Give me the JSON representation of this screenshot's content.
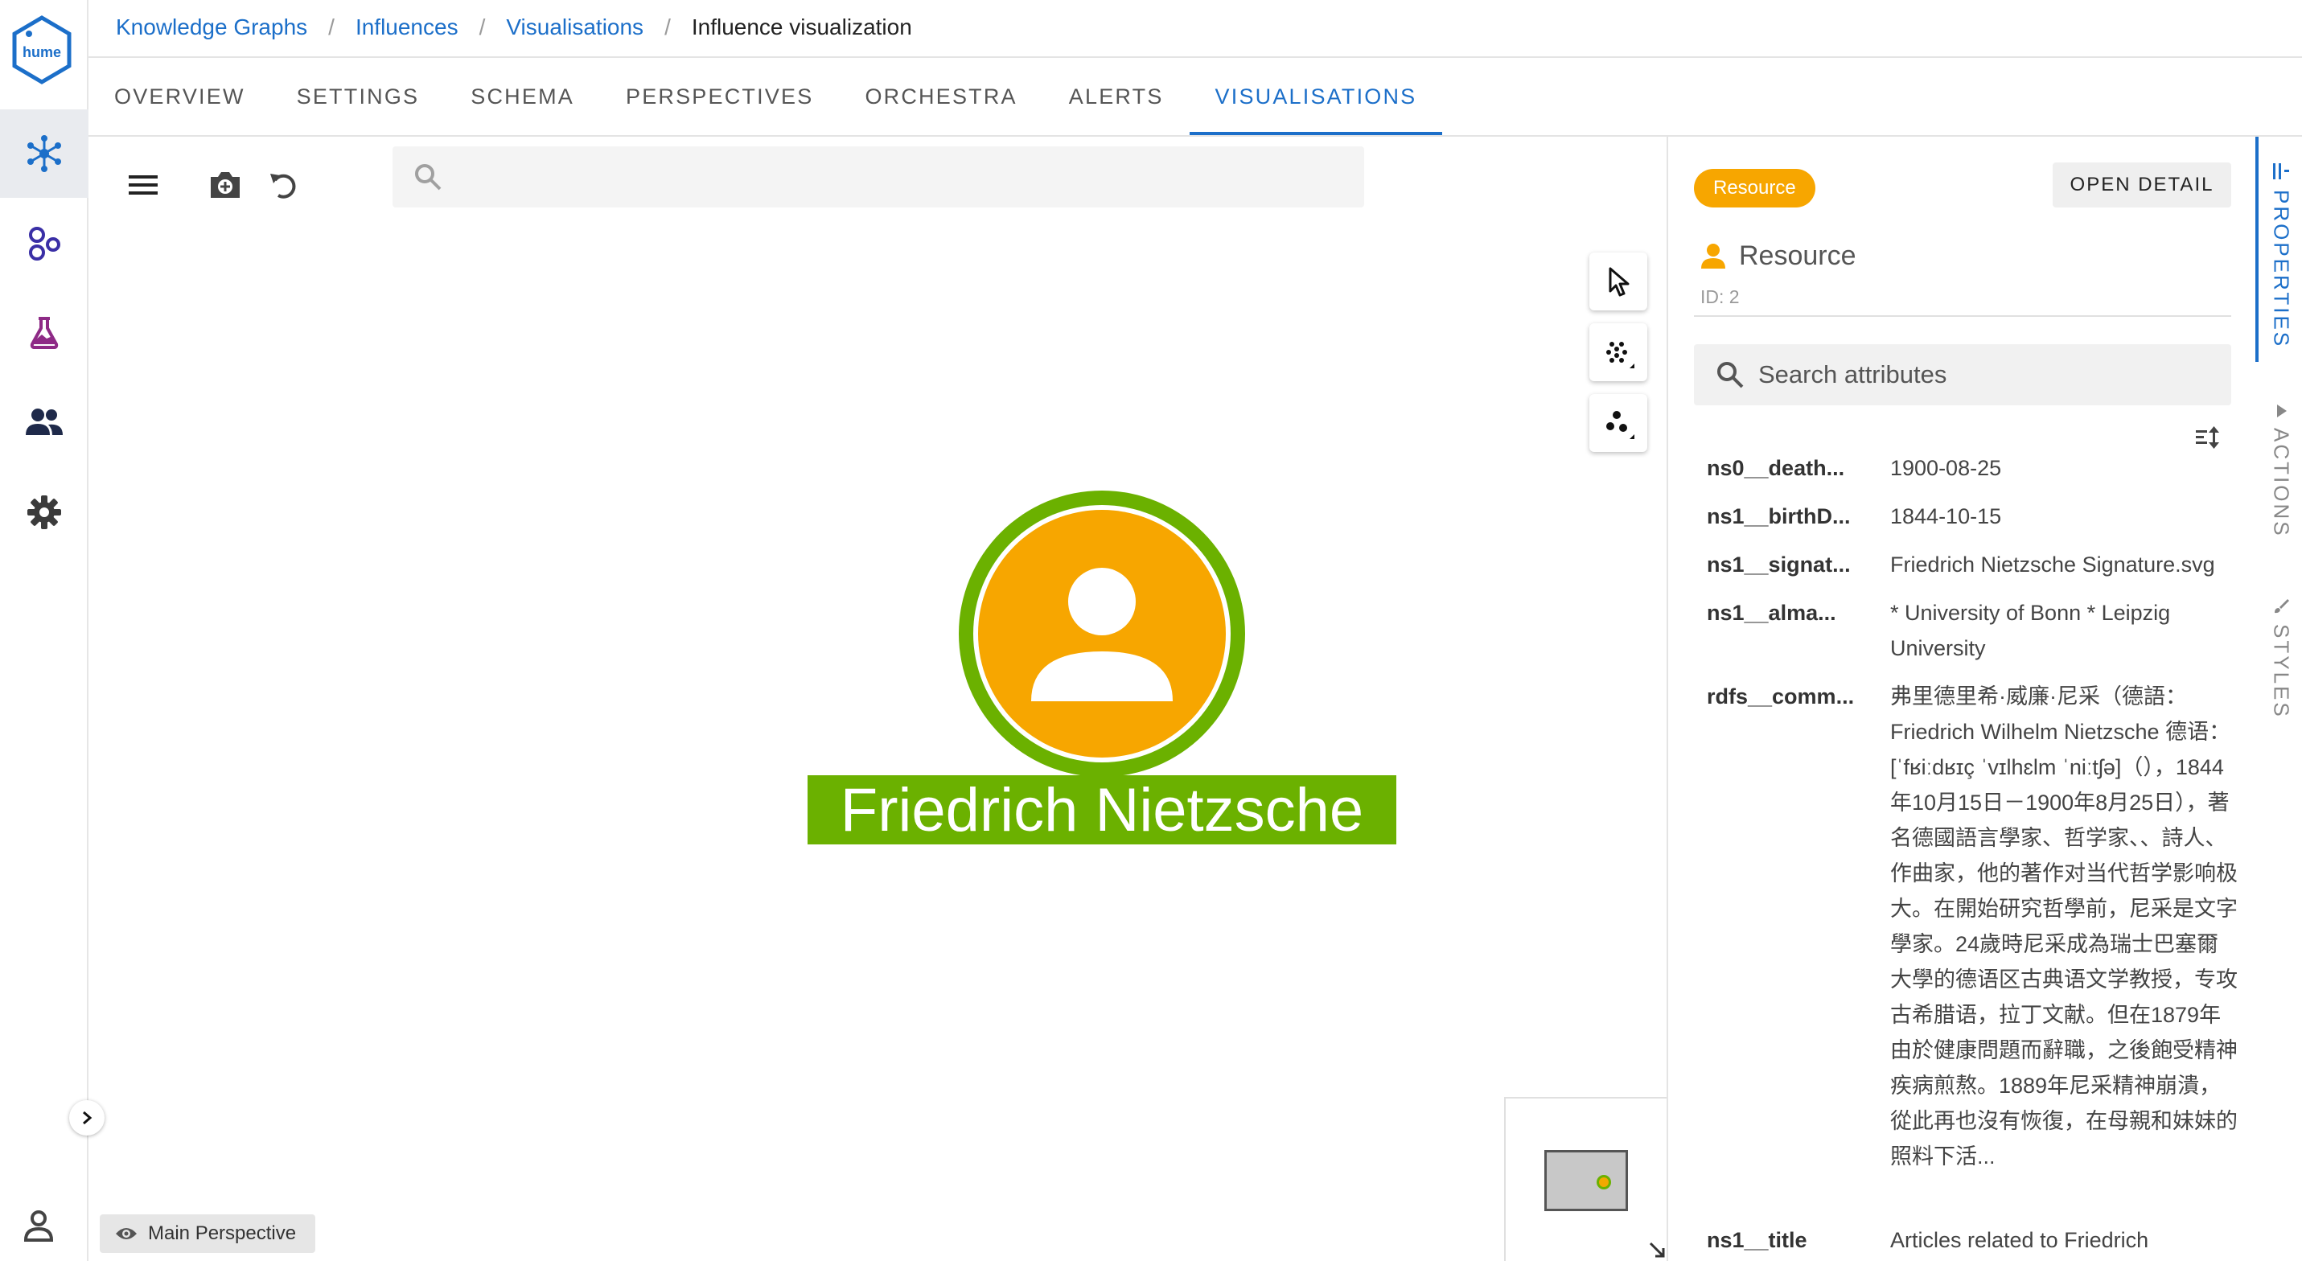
{
  "brand": {
    "logo_text": "hume"
  },
  "breadcrumb": {
    "items": [
      "Knowledge Graphs",
      "Influences",
      "Visualisations"
    ],
    "current": "Influence visualization",
    "separator": "/"
  },
  "tabs": [
    {
      "label": "OVERVIEW"
    },
    {
      "label": "SETTINGS"
    },
    {
      "label": "SCHEMA"
    },
    {
      "label": "PERSPECTIVES"
    },
    {
      "label": "ORCHESTRA"
    },
    {
      "label": "ALERTS"
    },
    {
      "label": "VISUALISATIONS",
      "active": true
    }
  ],
  "rail": {
    "items": [
      {
        "icon": "graph-network-icon",
        "active": true
      },
      {
        "icon": "bubbles-icon"
      },
      {
        "icon": "flask-icon"
      },
      {
        "icon": "people-icon"
      },
      {
        "icon": "gear-icon"
      }
    ],
    "bottom_icon": "user-account-icon"
  },
  "canvas": {
    "search_placeholder": "",
    "node": {
      "label": "Friedrich Nietzsche",
      "fill": "#F7A600",
      "ring": "#6BB100"
    },
    "perspective": "Main Perspective"
  },
  "panel": {
    "badge": "Resource",
    "open_detail": "OPEN DETAIL",
    "title": "Resource",
    "id_text": "ID: 2",
    "search_placeholder": "Search attributes",
    "attributes": [
      {
        "key": "ns0__death...",
        "value": "1900-08-25"
      },
      {
        "key": "ns1__birthD...",
        "value": "1844-10-15"
      },
      {
        "key": "ns1__signat...",
        "value": "Friedrich Nietzsche Signature.svg"
      },
      {
        "key": "ns1__alma...",
        "value": "* University of Bonn * Leipzig University"
      },
      {
        "key": "rdfs__comm...",
        "value": "弗里德里希·威廉·尼采（德語：Friedrich Wilhelm Nietzsche 德语：[ˈfʁiːdʁɪç ˈvɪlhɛlm ˈniːtʃə]（），1844年10月15日－1900年8月25日），著名德國語言學家、哲学家、、詩人、作曲家，他的著作对当代哲学影响极大。在開始研究哲學前，尼采是文字學家。24歲時尼采成為瑞士巴塞爾大學的德语区古典语文学教授，专攻古希腊语，拉丁文献。但在1879年由於健康問題而辭職，之後飽受精神疾病煎熬。1889年尼采精神崩潰，從此再也沒有恢復，在母親和妹妹的照料下活..."
      },
      {
        "key": "ns1__title",
        "value": "Articles related to Friedrich"
      }
    ]
  },
  "side_tabs": [
    {
      "label": "PROPERTIES",
      "icon": "properties-icon",
      "active": true
    },
    {
      "label": "ACTIONS",
      "icon": "triangle-icon"
    },
    {
      "label": "STYLES",
      "icon": "brush-icon"
    }
  ],
  "colors": {
    "accent": "#1C6FC9",
    "resource": "#F7A600",
    "node_ring": "#6BB100"
  }
}
